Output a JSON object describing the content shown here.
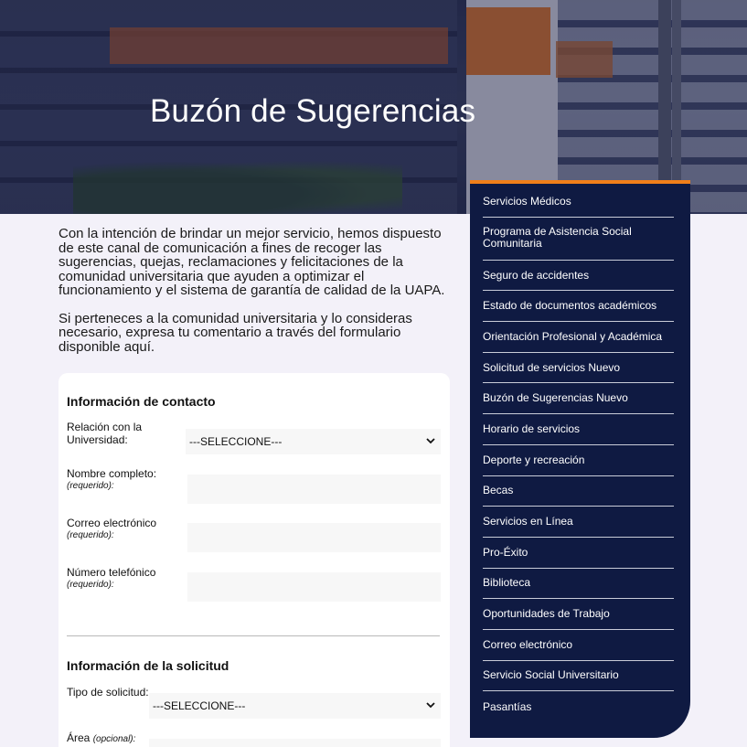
{
  "header": {
    "title": "Buzón de Sugerencias"
  },
  "intro": {
    "paragraph1": "Con la intención de brindar un mejor servicio, hemos dispuesto de este canal de comunicación a fines de recoger las sugerencias, quejas, reclamaciones y felicitaciones de la comunidad universitaria que ayuden a optimizar el funcionamiento y el sistema de garantía de calidad de la UAPA.",
    "paragraph2": "Si perteneces a la comunidad universitaria y lo consideras necesario, expresa tu comentario a través del formulario disponible aquí."
  },
  "form": {
    "contact_section_title": "Información de contacto",
    "relation_label": "Relación con la Universidad:",
    "relation_value": "---SELECCIONE---",
    "name_label": "Nombre completo:",
    "required_note": "(requerido):",
    "email_label": "Correo electrónico",
    "phone_label": "Número telefónico",
    "request_section_title": "Información de la solicitud",
    "type_label": "Tipo de solicitud:",
    "type_value": "---SELECCIONE---",
    "area_label": "Área",
    "optional_note": "(opcional):"
  },
  "sidebar": {
    "accent_color": "#f07f1a",
    "background_color": "#0f1a42",
    "items": [
      "Servicios Médicos",
      "Programa de Asistencia Social Comunitaria",
      "Seguro de accidentes",
      "Estado de documentos académicos",
      "Orientación Profesional y Académica",
      "Solicitud de servicios Nuevo",
      "Buzón de Sugerencias Nuevo",
      "Horario de servicios",
      "Deporte y recreación",
      "Becas",
      "Servicios en Línea",
      "Pro-Éxito",
      "Biblioteca",
      "Oportunidades de Trabajo",
      "Correo electrónico",
      "Servicio Social Universitario",
      "Pasantías"
    ]
  }
}
